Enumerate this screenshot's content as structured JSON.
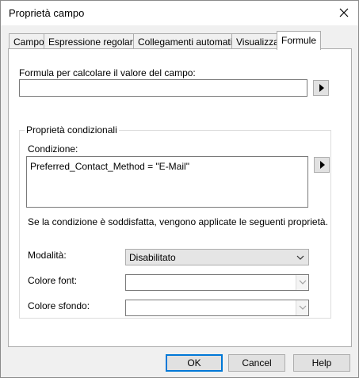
{
  "window": {
    "title": "Proprietà campo"
  },
  "tabs": [
    {
      "label": "Campo"
    },
    {
      "label": "Espressione regolare"
    },
    {
      "label": "Collegamenti automatici"
    },
    {
      "label": "Visualizza"
    },
    {
      "label": "Formule",
      "active": true
    }
  ],
  "formula": {
    "label": "Formula per calcolare il valore del campo:",
    "value": ""
  },
  "conditional": {
    "group_label": "Proprietà condizionali",
    "condition_label": "Condizione:",
    "condition_value": "Preferred_Contact_Method = \"E-Mail\"",
    "note": "Se la condizione è soddisfatta, vengono applicate le seguenti proprietà.",
    "mode_label": "Modalità:",
    "mode_value": "Disabilitato",
    "font_color_label": "Colore font:",
    "font_color_value": "",
    "bg_color_label": "Colore sfondo:",
    "bg_color_value": ""
  },
  "buttons": {
    "ok": "OK",
    "cancel": "Cancel",
    "help": "Help"
  },
  "icons": {
    "close": "close-icon",
    "arrow": "play-arrow-icon",
    "dropdown": "chevron-down-icon"
  },
  "colors": {
    "focus_border": "#0078d7",
    "dialog_bg": "#f0f0f0"
  }
}
